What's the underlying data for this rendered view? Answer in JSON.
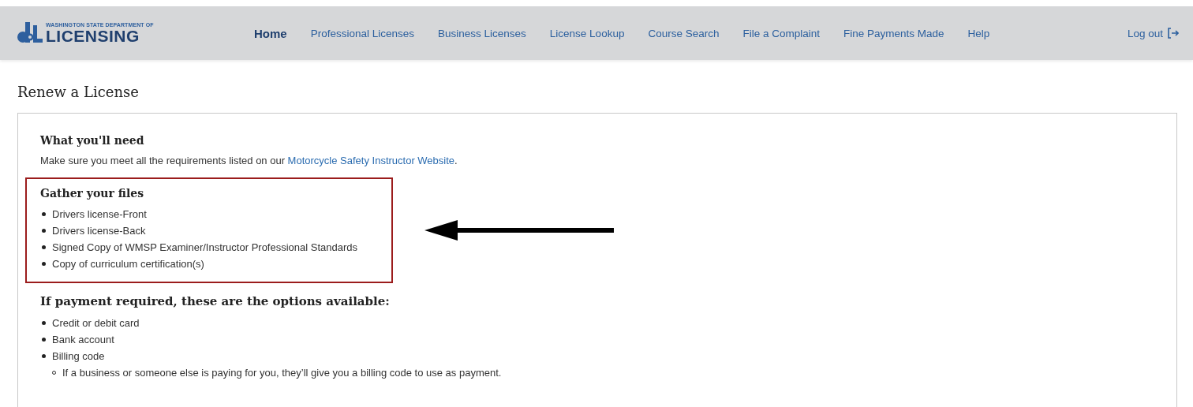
{
  "header": {
    "logo": {
      "top_line": "WASHINGTON STATE DEPARTMENT OF",
      "wordmark": "LICENSING"
    },
    "nav": [
      {
        "label": "Home",
        "selected": true
      },
      {
        "label": "Professional Licenses",
        "selected": false
      },
      {
        "label": "Business Licenses",
        "selected": false
      },
      {
        "label": "License Lookup",
        "selected": false
      },
      {
        "label": "Course Search",
        "selected": false
      },
      {
        "label": "File a Complaint",
        "selected": false
      },
      {
        "label": "Fine Payments Made",
        "selected": false
      },
      {
        "label": "Help",
        "selected": false
      }
    ],
    "logout": {
      "label": "Log out"
    }
  },
  "page_title": "Renew a License",
  "needs": {
    "heading": "What you'll need",
    "intro": "Make sure you meet all the requirements listed on our ",
    "link": "Motorcycle Safety Instructor Website",
    "intro_end": "."
  },
  "files": {
    "heading": "Gather your files",
    "items": [
      {
        "label": "Drivers license-Front"
      },
      {
        "label": "Drivers license-Back"
      },
      {
        "label": "Signed Copy of WMSP Examiner/Instructor Professional Standards"
      },
      {
        "label": "Copy of curriculum certification(s)"
      }
    ]
  },
  "payment": {
    "heading": "If payment required, these are the options available:",
    "items": [
      {
        "label": "Credit or debit card"
      },
      {
        "label": "Bank account"
      },
      {
        "label": "Billing code",
        "children": [
          {
            "label": "If a business or someone else is paying for you, they’ll give you a billing code to use as payment."
          }
        ]
      }
    ]
  }
}
